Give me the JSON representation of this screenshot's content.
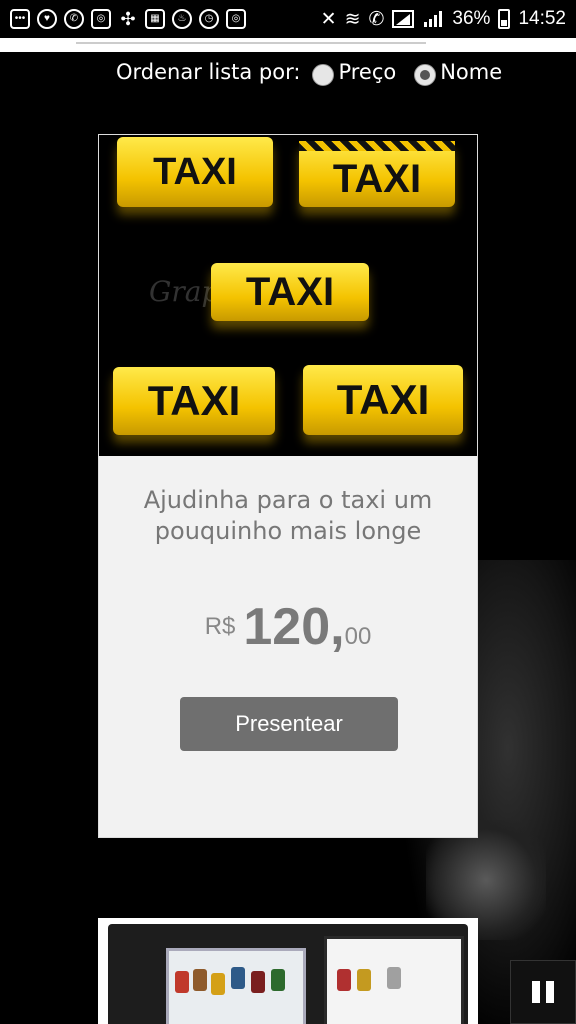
{
  "status_bar": {
    "battery_percent": "36%",
    "time": "14:52",
    "icons": [
      "chat-icon",
      "heart-icon",
      "whatsapp-icon",
      "instagram-icon",
      "pinwheel-icon",
      "qr-icon",
      "flame-icon",
      "timer-icon",
      "instagram-icon",
      "mute-icon",
      "wifi-icon",
      "call-icon",
      "signal-icon",
      "signal-bars-icon",
      "battery-icon"
    ]
  },
  "sort": {
    "label": "Ordenar lista por:",
    "options": [
      {
        "label": "Preço",
        "checked": false
      },
      {
        "label": "Nome",
        "checked": true
      }
    ]
  },
  "cards": [
    {
      "image_text": [
        "TAXI",
        "TAXI",
        "TAXI",
        "TAXI",
        "TAXI"
      ],
      "watermark": "Graphic stock",
      "title_line1": "Ajudinha para o taxi um",
      "title_line2": "pouquinho mais longe",
      "price_currency": "R$",
      "price_main": "120,",
      "price_cents": "00",
      "button_label": "Presentear"
    }
  ],
  "colors": {
    "background": "#000000",
    "card": "#f2f2f2",
    "button": "#6f6f6f",
    "taxi_yellow": "#f4c300"
  }
}
